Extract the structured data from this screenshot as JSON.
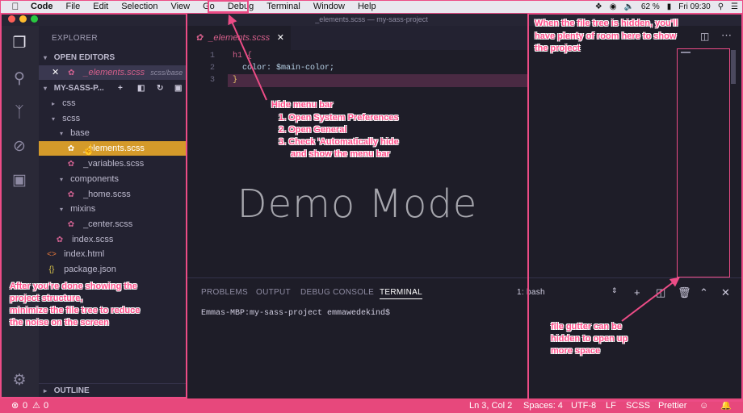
{
  "menubar": {
    "apple": "",
    "app": "Code",
    "items": [
      "File",
      "Edit",
      "Selection",
      "View",
      "Go",
      "Debug",
      "Terminal",
      "Window",
      "Help"
    ],
    "battery": "62 %",
    "clock": "Fri 09:30"
  },
  "window": {
    "title": "_elements.scss — my-sass-project"
  },
  "sidebar": {
    "explorer_title": "EXPLORER",
    "open_editors_title": "OPEN EDITORS",
    "open_editor": {
      "name": "_elements.scss",
      "path": "scss/base"
    },
    "project_title": "MY-SASS-P...",
    "tree": [
      {
        "label": "css",
        "type": "folder"
      },
      {
        "label": "scss",
        "type": "folder"
      },
      {
        "label": "base",
        "type": "folder"
      },
      {
        "label": "_elements.scss",
        "type": "sass"
      },
      {
        "label": "_variables.scss",
        "type": "sass"
      },
      {
        "label": "components",
        "type": "folder"
      },
      {
        "label": "_home.scss",
        "type": "sass"
      },
      {
        "label": "mixins",
        "type": "folder"
      },
      {
        "label": "_center.scss",
        "type": "sass"
      },
      {
        "label": "index.scss",
        "type": "sass"
      },
      {
        "label": "index.html",
        "type": "html"
      },
      {
        "label": "package.json",
        "type": "json"
      }
    ],
    "outline_title": "OUTLINE"
  },
  "editor": {
    "tab": "_elements.scss",
    "lines": [
      {
        "n": "1",
        "text": "h1 {"
      },
      {
        "n": "2",
        "text": "  color: $main-color;"
      },
      {
        "n": "3",
        "text": "}"
      }
    ],
    "overlay": "Demo Mode"
  },
  "panel": {
    "tabs": [
      "PROBLEMS",
      "OUTPUT",
      "DEBUG CONSOLE",
      "TERMINAL"
    ],
    "active_tab": "TERMINAL",
    "terminal_select": "1: bash",
    "prompt": "Emmas-MBP:my-sass-project emmawedekind$"
  },
  "status": {
    "errors": "0",
    "warnings": "0",
    "cursor": "Ln 3, Col 2",
    "spaces": "Spaces: 4",
    "encoding": "UTF-8",
    "eol": "LF",
    "language": "SCSS",
    "formatter": "Prettier"
  },
  "annotations": {
    "menu": [
      "Hide menu bar",
      "1. Open System Preferences",
      "2. Open General",
      "3. Check 'Automatically hide",
      "and show the menu bar"
    ],
    "filetree": [
      "When the file tree is hidden, you'll",
      "have plenty of room here to show",
      "the project"
    ],
    "sidebar": [
      "After you're done showing the",
      "project structure,",
      "minimize the file tree to reduce",
      "the noise on the screen"
    ],
    "gutter": [
      "file gutter can be",
      "hidden to open up",
      "more space"
    ]
  },
  "colors": {
    "accent": "#ec4c86",
    "status_bar": "#e7487c",
    "selection": "#d49a2a"
  }
}
